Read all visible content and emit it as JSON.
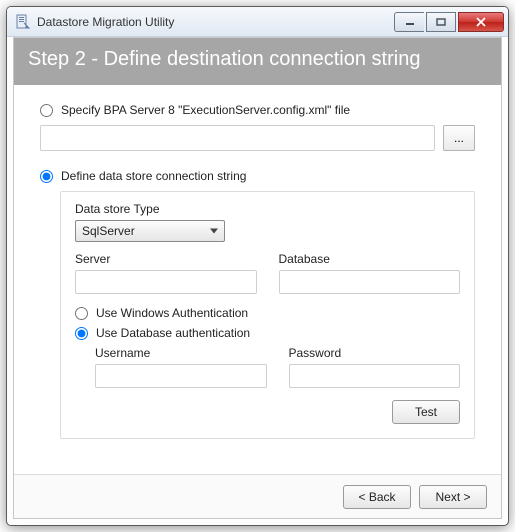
{
  "window": {
    "title": "Datastore Migration Utility"
  },
  "header": {
    "step_title": "Step 2 - Define destination connection string"
  },
  "options": {
    "specify_config_label": "Specify BPA Server 8 \"ExecutionServer.config.xml\" file",
    "browse_label": "...",
    "define_conn_label": "Define data store connection string",
    "selected": "define"
  },
  "datastore": {
    "type_label": "Data store Type",
    "type_value": "SqlServer",
    "server_label": "Server",
    "server_value": "",
    "database_label": "Database",
    "database_value": ""
  },
  "auth": {
    "windows_label": "Use Windows Authentication",
    "database_label": "Use Database authentication",
    "selected": "database",
    "username_label": "Username",
    "username_value": "",
    "password_label": "Password",
    "password_value": ""
  },
  "buttons": {
    "test": "Test",
    "back": "< Back",
    "next": "Next >"
  }
}
